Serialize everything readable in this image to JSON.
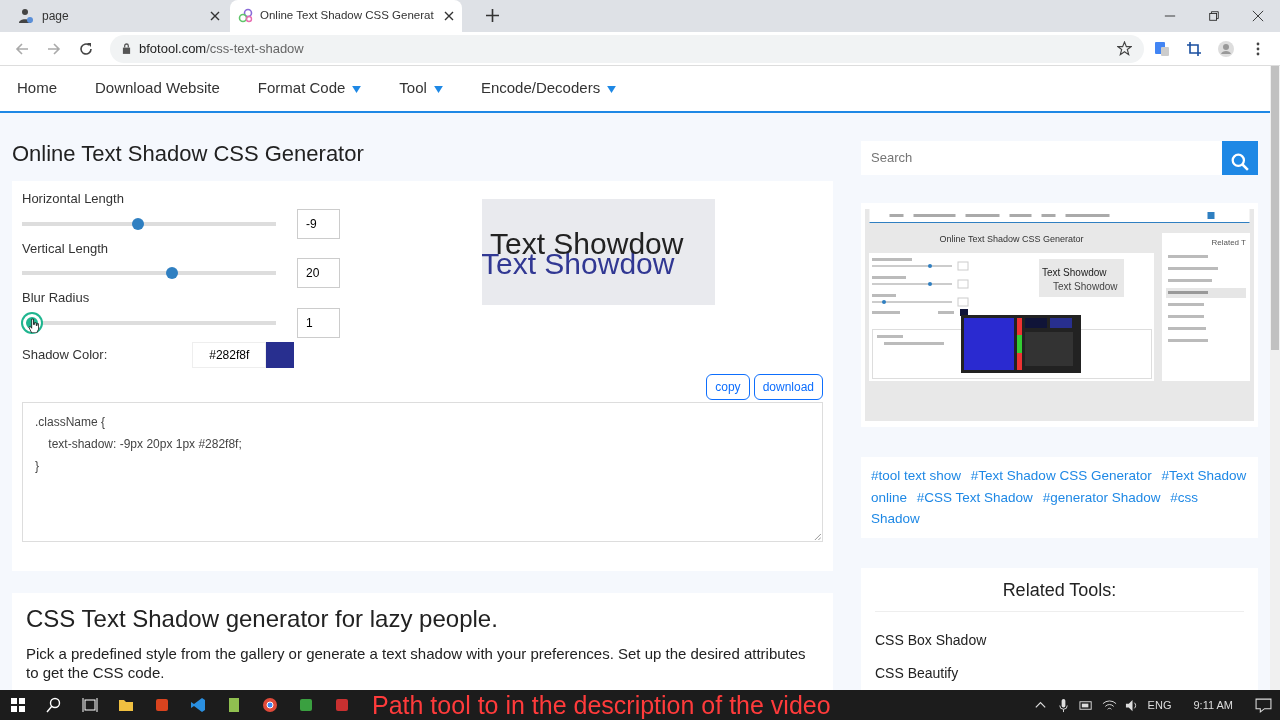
{
  "browser": {
    "tabs": [
      {
        "title": "page",
        "selected": false
      },
      {
        "title": "Online Text Shadow CSS Generat",
        "selected": true
      }
    ],
    "url_host": "bfotool.com",
    "url_path": "/css-text-shadow"
  },
  "nav": [
    {
      "label": "Home",
      "dropdown": false
    },
    {
      "label": "Download Website",
      "dropdown": false
    },
    {
      "label": "Format Code",
      "dropdown": true
    },
    {
      "label": "Tool",
      "dropdown": true
    },
    {
      "label": "Encode/Decoders",
      "dropdown": true
    }
  ],
  "page_title": "Online Text Shadow CSS Generator",
  "controls": [
    {
      "label": "Horizontal Length",
      "level": 0.457,
      "value": "-9",
      "active": false
    },
    {
      "label": "Vertical Length",
      "level": 0.59,
      "value": "20",
      "active": false
    },
    {
      "label": "Blur Radius",
      "level": 0.04,
      "value": "1",
      "active": true
    }
  ],
  "shadow_color": {
    "label": "Shadow Color:",
    "value": "#282f8f"
  },
  "preview": {
    "text": "Text Showdow",
    "shadow_text": "Text Showdow"
  },
  "buttons": [
    "copy",
    "download"
  ],
  "code_lines": [
    ".className {",
    "    text-shadow: -9px 20px 1px #282f8f;",
    "}"
  ],
  "section": {
    "heading": "CSS Text Shadow generator for lazy people.",
    "paragraph": "Pick a predefined style from the gallery or generate a text shadow with your preferences. Set up the desired attributes to get the CSS code."
  },
  "search": {
    "placeholder": "Search"
  },
  "thumbnail": {
    "title": "Online Text Shadow CSS Generator",
    "preview": "Text Showdow",
    "shadow": "Text Showdow",
    "related_title": "Related T"
  },
  "tags": [
    "#tool text show",
    "#Text Shadow CSS Generator",
    "#Text Shadow online",
    "#CSS Text Shadow",
    "#generator Shadow",
    "#css Shadow"
  ],
  "related": {
    "title": "Related Tools:",
    "items": [
      "CSS Box Shadow",
      "CSS Beautify"
    ]
  },
  "taskbar": {
    "language": "ENG",
    "time": "9:11 AM"
  },
  "caption": "Path tool to in the description of the video"
}
